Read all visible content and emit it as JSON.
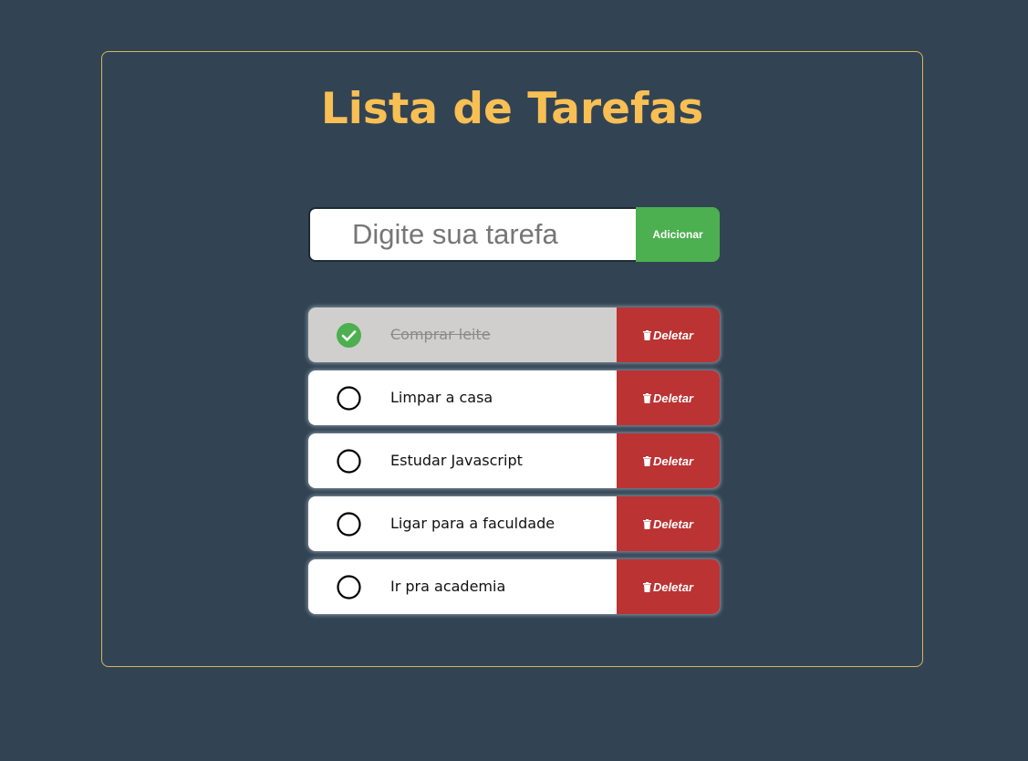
{
  "app": {
    "title": "Lista de Tarefas"
  },
  "form": {
    "placeholder": "Digite sua tarefa",
    "value": "",
    "add_label": "Adicionar"
  },
  "tasks": [
    {
      "text": "Comprar leite",
      "done": true,
      "delete_label": "Deletar"
    },
    {
      "text": "Limpar a casa",
      "done": false,
      "delete_label": "Deletar"
    },
    {
      "text": "Estudar Javascript",
      "done": false,
      "delete_label": "Deletar"
    },
    {
      "text": "Ligar para a faculdade",
      "done": false,
      "delete_label": "Deletar"
    },
    {
      "text": "Ir pra academia",
      "done": false,
      "delete_label": "Deletar"
    }
  ],
  "icons": {
    "done": "check-circle-icon",
    "pending": "empty-circle-icon",
    "delete": "trash-icon"
  },
  "colors": {
    "background": "#324454",
    "accent": "#f8bf54",
    "add_button": "#4caf50",
    "delete_button": "#bb3333",
    "done_row": "#d0cfcd",
    "check": "#4caf50"
  }
}
